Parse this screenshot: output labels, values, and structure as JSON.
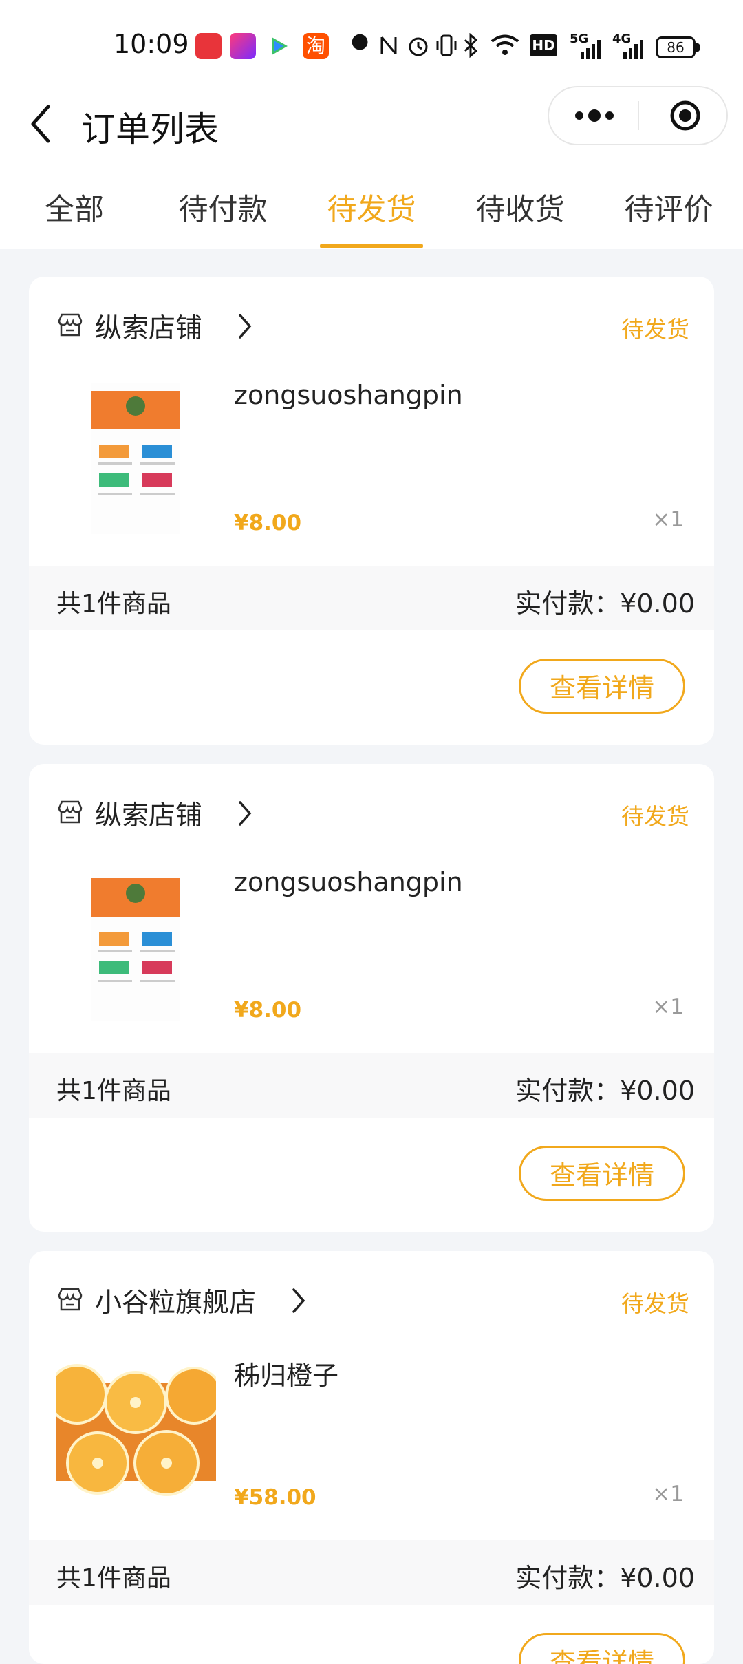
{
  "status_bar": {
    "time": "10:09",
    "app_icons": [
      "alipay-app-icon",
      "video-app-icon",
      "tencent-video-app-icon",
      "taobao-app-icon"
    ],
    "taobao_label": "淘",
    "battery": "86",
    "network_5g": "5G",
    "network_4g": "4G",
    "hd_label": "HD"
  },
  "navbar": {
    "title": "订单列表"
  },
  "tabs": [
    {
      "label": "全部"
    },
    {
      "label": "待付款"
    },
    {
      "label": "待发货"
    },
    {
      "label": "待收货"
    },
    {
      "label": "待评价"
    }
  ],
  "active_tab_index": 2,
  "colors": {
    "accent": "#f1a81c",
    "page_bg": "#f3f5f8"
  },
  "orders": [
    {
      "shop_name": "纵索店铺",
      "status": "待发货",
      "product_name": "zongsuoshangpin",
      "price": "¥8.00",
      "quantity": "×1",
      "item_count": "共1件商品",
      "paid": "实付款：¥0.00",
      "detail_button": "查看详情"
    },
    {
      "shop_name": "纵索店铺",
      "status": "待发货",
      "product_name": "zongsuoshangpin",
      "price": "¥8.00",
      "quantity": "×1",
      "item_count": "共1件商品",
      "paid": "实付款：¥0.00",
      "detail_button": "查看详情"
    },
    {
      "shop_name": "小谷粒旗舰店",
      "status": "待发货",
      "product_name": "秭归橙子",
      "price": "¥58.00",
      "quantity": "×1",
      "item_count": "共1件商品",
      "paid": "实付款：¥0.00",
      "detail_button": "查看详情"
    }
  ]
}
